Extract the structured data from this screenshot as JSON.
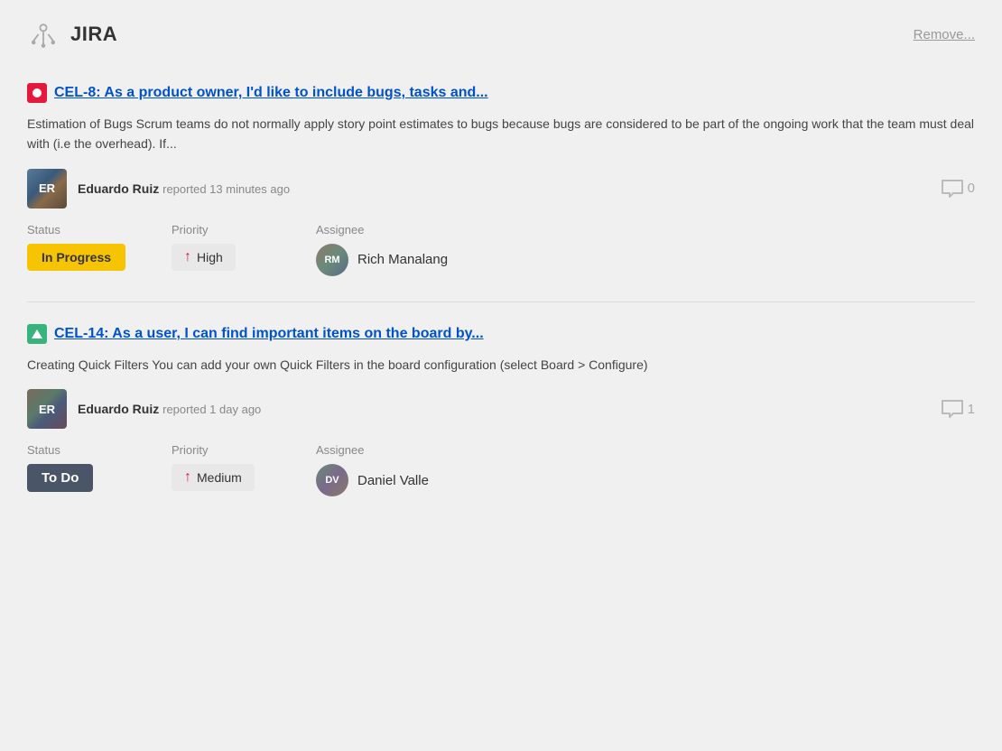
{
  "app": {
    "title": "JIRA",
    "remove_label": "Remove..."
  },
  "issues": [
    {
      "id": "issue-1",
      "type": "bug",
      "type_label": "Bug",
      "title": "CEL-8: As a product owner, I'd like to include bugs, tasks and...",
      "description": "Estimation of Bugs Scrum teams do not normally apply story point estimates to bugs because bugs are considered to be part of the ongoing work that the team must deal with (i.e the overhead). If...",
      "reporter_name": "Eduardo Ruiz",
      "reporter_action": "reported",
      "reported_time": "13 minutes ago",
      "comment_count": "0",
      "status": "In Progress",
      "status_type": "inprogress",
      "priority": "High",
      "priority_type": "high",
      "assignee_name": "Rich Manalang"
    },
    {
      "id": "issue-2",
      "type": "story",
      "type_label": "Story",
      "title": "CEL-14: As a user, I can find important items on the board by...",
      "description": "Creating Quick Filters You can add your own Quick Filters in the board configuration (select Board > Configure)",
      "reporter_name": "Eduardo Ruiz",
      "reporter_action": "reported",
      "reported_time": "1 day ago",
      "comment_count": "1",
      "status": "To Do",
      "status_type": "todo",
      "priority": "Medium",
      "priority_type": "medium",
      "assignee_name": "Daniel Valle"
    }
  ],
  "labels": {
    "status": "Status",
    "priority": "Priority",
    "assignee": "Assignee"
  }
}
